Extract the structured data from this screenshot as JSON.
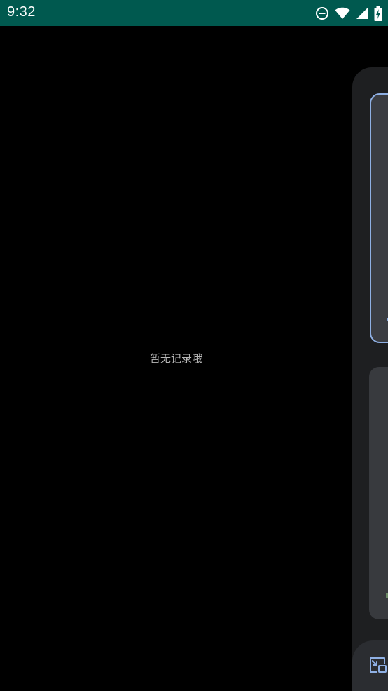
{
  "status_bar": {
    "time": "9:32",
    "icons": [
      "do-not-disturb-icon",
      "wifi-icon",
      "cell-signal-icon",
      "battery-charging-icon"
    ]
  },
  "main": {
    "empty_message": "暂无记录哦"
  },
  "side_panel": {
    "cards": [
      {
        "state": "selected"
      },
      {
        "state": "default"
      }
    ],
    "bottom_action_icon": "picture-in-picture-icon"
  },
  "colors": {
    "status_bar_bg": "#00594f",
    "background": "#000000",
    "panel_bg": "#1e1f21",
    "accent": "#8fb0e4"
  }
}
